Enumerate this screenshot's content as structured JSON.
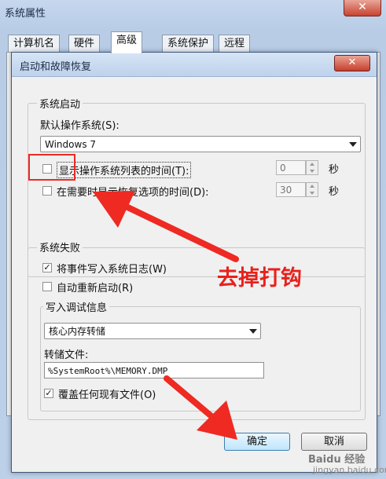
{
  "outer_window": {
    "title": "系统属性",
    "close_glyph": "✕",
    "tabs": [
      "计算机名",
      "硬件",
      "高级",
      "系统保护",
      "远程"
    ],
    "active_tab": "高级"
  },
  "dialog": {
    "title": "启动和故障恢复",
    "close_glyph": "✕",
    "startup": {
      "legend": "系统启动",
      "default_os_label": "默认操作系统(S):",
      "default_os_value": "Windows 7",
      "show_list_label": "显示操作系统列表的时间(T):",
      "show_list_checked": false,
      "show_list_seconds": "0",
      "show_recovery_label": "在需要时显示恢复选项的时间(D):",
      "show_recovery_checked": false,
      "show_recovery_seconds": "30",
      "seconds_unit": "秒"
    },
    "failure": {
      "legend": "系统失败",
      "write_event_label": "将事件写入系统日志(W)",
      "write_event_checked": true,
      "auto_restart_label": "自动重新启动(R)",
      "auto_restart_checked": false,
      "debug_info_legend": "写入调试信息",
      "debug_type_value": "核心内存转储",
      "dump_file_label": "转储文件:",
      "dump_file_value": "%SystemRoot%\\MEMORY.DMP",
      "overwrite_label": "覆盖任何现有文件(O)",
      "overwrite_checked": true
    },
    "buttons": {
      "ok": "确定",
      "cancel": "取消"
    }
  },
  "annotation": {
    "text": "去掉打钩",
    "color": "#e8211c"
  },
  "watermark": {
    "text": "Baidu 经验",
    "sub": "jingyan.baidu.com"
  }
}
